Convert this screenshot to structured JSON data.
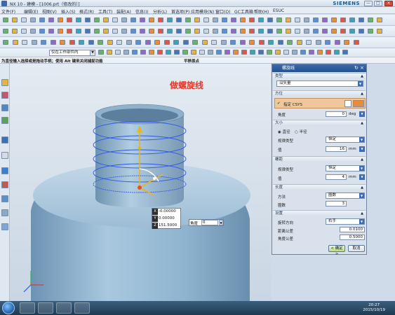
{
  "window": {
    "title": "NX 10 - 建模 - [1006.prt（修改的）]",
    "brand": "SIEMENS",
    "controls": [
      "—",
      "□",
      "×"
    ]
  },
  "menu": {
    "items": [
      "文件(F)",
      "编辑(E)",
      "视图(V)",
      "插入(S)",
      "格式(R)",
      "工具(T)",
      "装配(A)",
      "信息(I)",
      "分析(L)",
      "首选项(P)",
      "应用模块(N)",
      "窗口(O)",
      "GC工具箱",
      "帮助(H)",
      "ESUC"
    ]
  },
  "filter": {
    "value": "仅在工作部件内"
  },
  "status": {
    "prompt": "为直径输入选择或是拖动手柄；使用 Alt 键来关闭捕捉功能",
    "message": "平移原点"
  },
  "viewport": {
    "annotation": "做螺旋线",
    "coords": [
      {
        "axis": "X",
        "value": "-0.00000"
      },
      {
        "axis": "Y",
        "value": "0.00000"
      },
      {
        "axis": "Z",
        "value": "151.5000"
      }
    ],
    "angle_label": "角度",
    "angle_value": "0"
  },
  "dialog": {
    "title": "螺旋线",
    "type_section": "类型",
    "type_value": "沿矢量",
    "orientation_section": "方位",
    "orientation_item": "指定 CSYS",
    "angle_label": "角度",
    "angle_value": "0",
    "angle_unit": "deg",
    "size_section": "大小",
    "radio_diameter": "直径",
    "radio_radius": "半径",
    "size_law_label": "规律类型",
    "size_law_value": "恒定",
    "size_value_label": "值",
    "size_value": "16",
    "size_unit": "mm",
    "pitch_section": "螺距",
    "pitch_law_label": "规律类型",
    "pitch_law_value": "恒定",
    "pitch_value_label": "值",
    "pitch_value": "4",
    "pitch_unit": "mm",
    "length_section": "长度",
    "method_label": "方法",
    "method_value": "圈数",
    "turns_label": "圈数",
    "turns_value": "3",
    "settings_section": "设置",
    "rotation_label": "旋转方向",
    "rotation_value": "右手",
    "distance_tol_label": "距离公差",
    "distance_tol_value": "0.0100",
    "angle_tol_label": "角度公差",
    "angle_tol_value": "0.5000",
    "ok": "< 确定 >",
    "cancel": "取消"
  },
  "taskbar": {
    "time": "20:27",
    "date": "2015/10/19"
  },
  "colors": {
    "model": "#8fb4cf",
    "helix": "#2f57e6",
    "annotation": "#e03b2a",
    "dialog_title": "#2d5c98"
  }
}
